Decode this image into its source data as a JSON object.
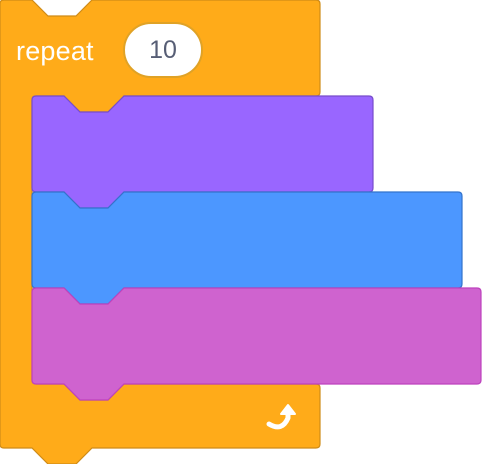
{
  "repeat_block": {
    "label": "repeat",
    "count": "10",
    "colors": {
      "fill": "#ffab19",
      "border": "#cf8b17",
      "input_border": "#e0a226",
      "input_text": "#575e75",
      "label_text": "#ffffff"
    },
    "end_icon": "loop-arrow-icon"
  },
  "inner_blocks": [
    {
      "name": "looks-block",
      "fill": "#9966ff",
      "border": "#774dcb"
    },
    {
      "name": "motion-block",
      "fill": "#4c97ff",
      "border": "#3373cc"
    },
    {
      "name": "custom-block",
      "fill": "#cf63cf",
      "border": "#bd42bd"
    }
  ]
}
